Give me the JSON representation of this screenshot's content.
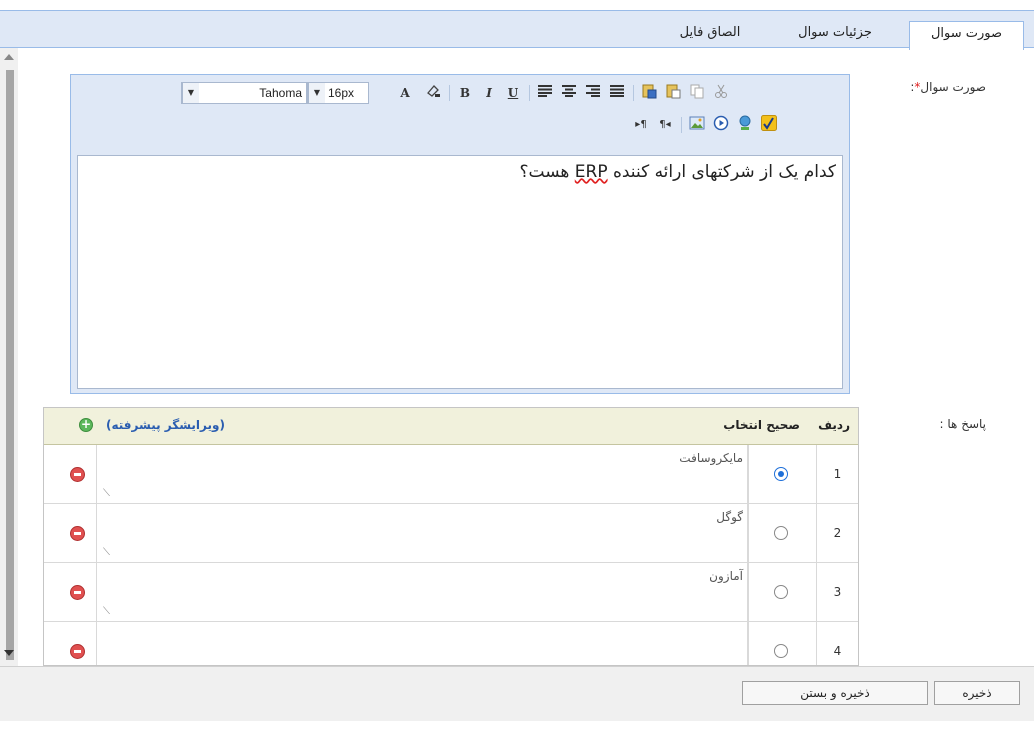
{
  "tabs": [
    {
      "label": "صورت سوال",
      "active": true
    },
    {
      "label": "جزئیات سوال",
      "active": false
    },
    {
      "label": "الصاق فایل",
      "active": false
    }
  ],
  "question_form": {
    "question_label": "صورت سوال",
    "required_mark": "*",
    "question_colon": ":",
    "answers_label": "پاسخ ها :"
  },
  "toolbar": {
    "font_family": "Tahoma",
    "font_size": "16px",
    "icons": [
      "cut-icon",
      "copy-icon",
      "paste-icon",
      "paste-word-icon",
      "align-justify-icon",
      "align-right-icon",
      "align-center-icon",
      "align-left-icon",
      "underline-icon",
      "italic-icon",
      "bold-icon",
      "highlight-color-icon",
      "font-color-icon",
      "formula-icon",
      "link-icon",
      "media-icon",
      "image-icon",
      "rtl-icon",
      "ltr-icon"
    ],
    "bold": "B",
    "italic": "I",
    "underline": "U",
    "font_color": "A"
  },
  "editor": {
    "text_before": "کدام یک از شرکتهای ارائه کننده ",
    "text_erp": "ERP",
    "text_after": " هست؟"
  },
  "answers_grid": {
    "col_row": "ردیف",
    "col_correct": "صحیح انتخاب",
    "advanced_editor": "(ویرایشگر پیشرفته)",
    "rows": [
      {
        "num": "1",
        "text": "مایکروسافت",
        "selected": true
      },
      {
        "num": "2",
        "text": "گوگل",
        "selected": false
      },
      {
        "num": "3",
        "text": "آمازون",
        "selected": false
      },
      {
        "num": "4",
        "text": "",
        "selected": false
      }
    ]
  },
  "footer": {
    "save": "ذخیره",
    "save_close": "ذخیره و بستن"
  },
  "colors": {
    "tab_bar": "#dfe8f6",
    "accent_border": "#99bbe8",
    "grid_header": "#f1f1dc",
    "link": "#2a5db0",
    "radio_selected": "#1e6fd9",
    "delete": "#e05050",
    "add": "#5cb85c"
  }
}
